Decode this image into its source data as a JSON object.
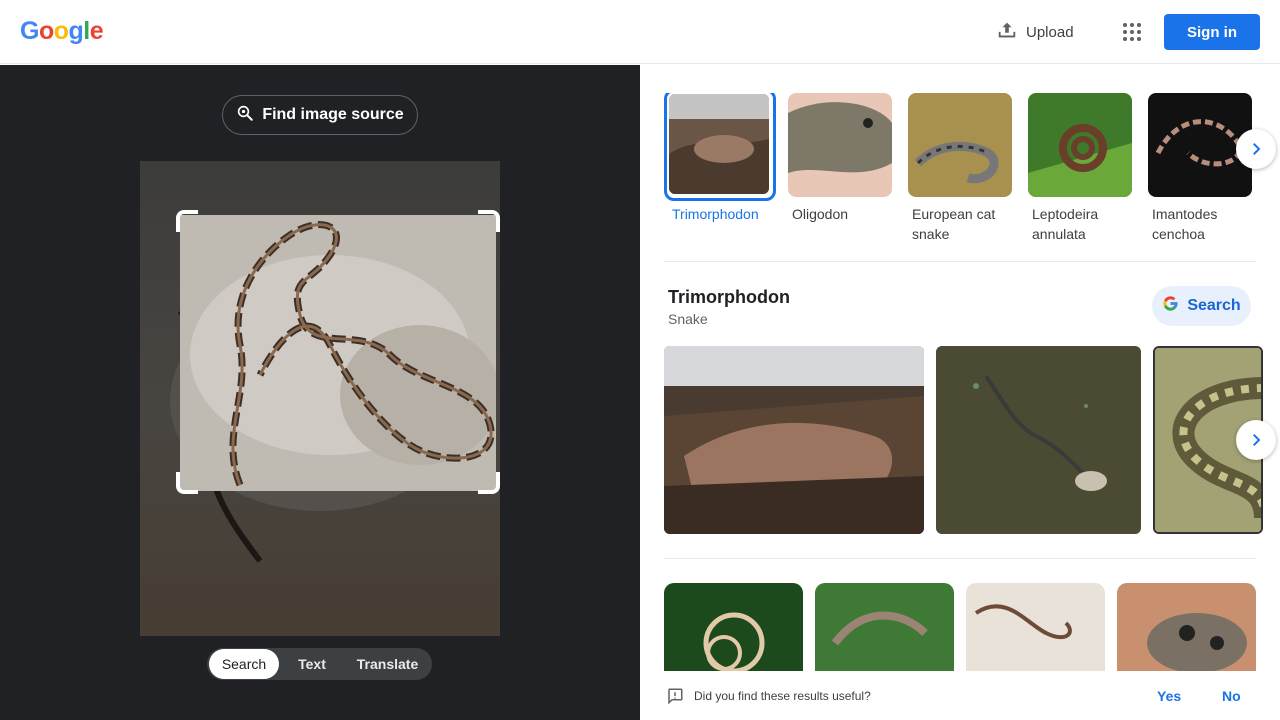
{
  "header": {
    "logo": [
      "G",
      "o",
      "o",
      "g",
      "l",
      "e"
    ],
    "logo_colors": [
      "#4285f4",
      "#ea4335",
      "#fbbc05",
      "#4285f4",
      "#34a853",
      "#ea4335"
    ],
    "upload_label": "Upload",
    "signin_label": "Sign in"
  },
  "left": {
    "find_source_label": "Find image source",
    "modes": [
      {
        "label": "Search",
        "active": true
      },
      {
        "label": "Text",
        "active": false
      },
      {
        "label": "Translate",
        "active": false
      }
    ]
  },
  "matches": [
    {
      "label": "Trimorphodon",
      "selected": true
    },
    {
      "label": "Oligodon",
      "selected": false
    },
    {
      "label": "European cat snake",
      "selected": false
    },
    {
      "label": "Leptodeira annulata",
      "selected": false
    },
    {
      "label": "Imantodes cenchoa",
      "selected": false
    }
  ],
  "entity": {
    "title": "Trimorphodon",
    "subtitle": "Snake",
    "search_label": "Search"
  },
  "feedback": {
    "question": "Did you find these results useful?",
    "yes": "Yes",
    "no": "No"
  },
  "colors": {
    "accent": "#1a73e8",
    "left_pane_bg": "#202124"
  }
}
